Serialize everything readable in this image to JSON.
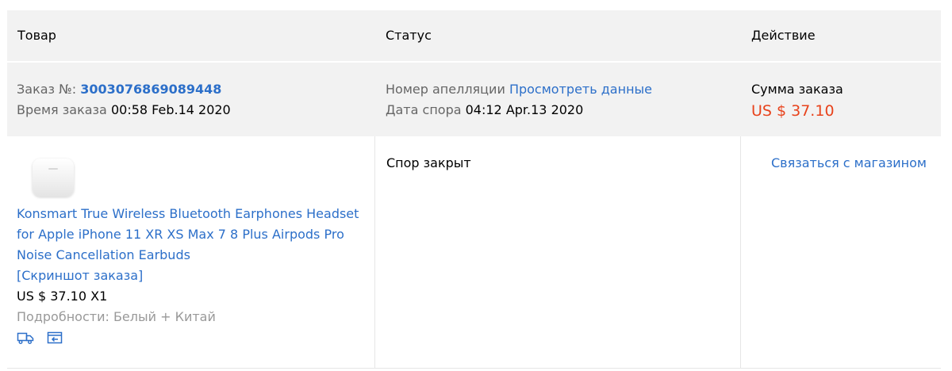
{
  "header": {
    "product_col": "Товар",
    "status_col": "Статус",
    "action_col": "Действие"
  },
  "order": {
    "order_no_label": "Заказ №:",
    "order_no": "3003076869089448",
    "order_time_label": "Время заказа",
    "order_time": "00:58 Feb.14 2020",
    "appeal_label": "Номер апелляции",
    "appeal_link": "Просмотреть данные",
    "dispute_date_label": "Дата спора",
    "dispute_date": "04:12 Apr.13 2020",
    "total_label": "Сумма заказа",
    "total_amount": "US $ 37.10"
  },
  "item": {
    "title": "Konsmart True Wireless Bluetooth Earphones Headset for Apple iPhone 11 XR XS Max 7 8 Plus Airpods Pro Noise Cancellation Earbuds",
    "snapshot_link": "[Скриншот заказа]",
    "price_qty": "US $ 37.10 X1",
    "details": "Подробности: Белый + Китай",
    "status": "Спор закрыт",
    "action_link": "Связаться с магазином",
    "icons": [
      "delivery-truck-icon",
      "return-icon"
    ]
  },
  "colors": {
    "link": "#2c6fc9",
    "amount": "#e8431c",
    "header_bg": "#f2f2f2",
    "muted": "#666666",
    "detail_gray": "#999999"
  }
}
